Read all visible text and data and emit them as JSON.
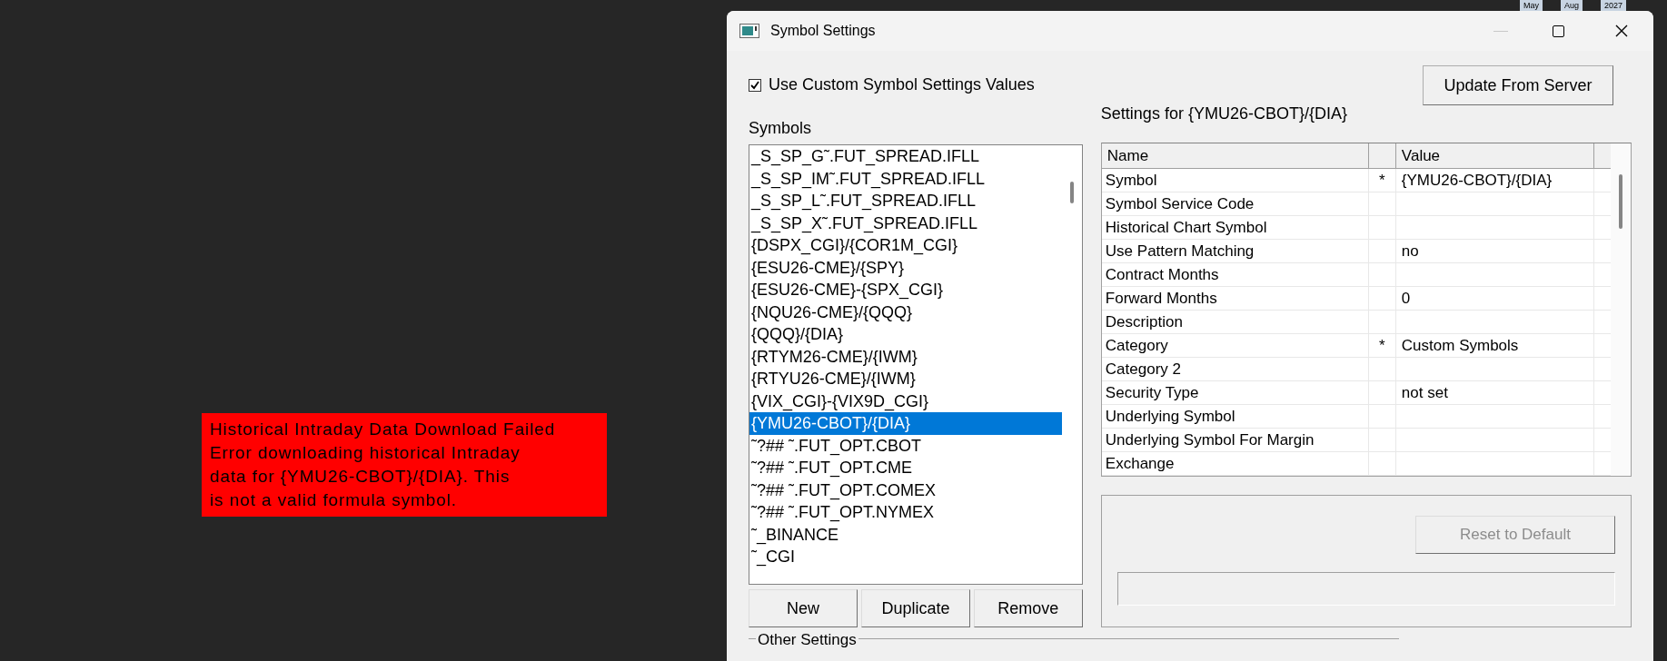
{
  "background_labels": [
    "May",
    "Aug",
    "2027"
  ],
  "error_message": {
    "title": "Historical Intraday Data Download Failed",
    "lines": [
      "Error downloading historical Intraday",
      "data for {YMU26-CBOT}/{DIA}. This",
      "is not a valid formula symbol."
    ]
  },
  "window": {
    "title": "Symbol Settings",
    "minimize_disabled": true
  },
  "custom_values": {
    "label": "Use Custom Symbol Settings Values",
    "checked": true
  },
  "update_button": "Update From Server",
  "symbols": {
    "label": "Symbols",
    "items": [
      {
        "name": "_S_SP_G˜.FUT_SPREAD.IFLL",
        "selected": false
      },
      {
        "name": "_S_SP_IM˜.FUT_SPREAD.IFLL",
        "selected": false
      },
      {
        "name": "_S_SP_L˜.FUT_SPREAD.IFLL",
        "selected": false
      },
      {
        "name": "_S_SP_X˜.FUT_SPREAD.IFLL",
        "selected": false
      },
      {
        "name": "{DSPX_CGI}/{COR1M_CGI}",
        "selected": false
      },
      {
        "name": "{ESU26-CME}/{SPY}",
        "selected": false
      },
      {
        "name": "{ESU26-CME}-{SPX_CGI}",
        "selected": false
      },
      {
        "name": "{NQU26-CME}/{QQQ}",
        "selected": false
      },
      {
        "name": "{QQQ}/{DIA}",
        "selected": false
      },
      {
        "name": "{RTYM26-CME}/{IWM}",
        "selected": false
      },
      {
        "name": "{RTYU26-CME}/{IWM}",
        "selected": false
      },
      {
        "name": "{VIX_CGI}-{VIX9D_CGI}",
        "selected": false
      },
      {
        "name": "{YMU26-CBOT}/{DIA}",
        "selected": true
      },
      {
        "name": "˜?## ˜.FUT_OPT.CBOT",
        "selected": false
      },
      {
        "name": "˜?## ˜.FUT_OPT.CME",
        "selected": false
      },
      {
        "name": "˜?## ˜.FUT_OPT.COMEX",
        "selected": false
      },
      {
        "name": "˜?## ˜.FUT_OPT.NYMEX",
        "selected": false
      },
      {
        "name": "˜_BINANCE",
        "selected": false
      },
      {
        "name": "˜_CGI",
        "selected": false
      }
    ]
  },
  "list_buttons": [
    "New",
    "Duplicate",
    "Remove"
  ],
  "settings": {
    "title": "Settings for {YMU26-CBOT}/{DIA}",
    "columns": [
      "Name",
      "Value"
    ],
    "rows": [
      {
        "name": "Symbol",
        "flag": "*",
        "value": "{YMU26-CBOT}/{DIA}"
      },
      {
        "name": "Symbol Service Code"
      },
      {
        "name": "Historical Chart Symbol"
      },
      {
        "name": "Use Pattern Matching",
        "value": "no"
      },
      {
        "name": "Contract Months"
      },
      {
        "name": "Forward Months",
        "value": "0"
      },
      {
        "name": "Description"
      },
      {
        "name": "Category",
        "flag": "*",
        "value": "Custom Symbols"
      },
      {
        "name": "Category 2"
      },
      {
        "name": "Security Type",
        "value": "not set"
      },
      {
        "name": "Underlying Symbol"
      },
      {
        "name": "Underlying Symbol For Margin"
      },
      {
        "name": "Exchange"
      }
    ]
  },
  "reset_button": {
    "label": "Reset to Default",
    "disabled": true
  },
  "other_settings": "Other Settings"
}
